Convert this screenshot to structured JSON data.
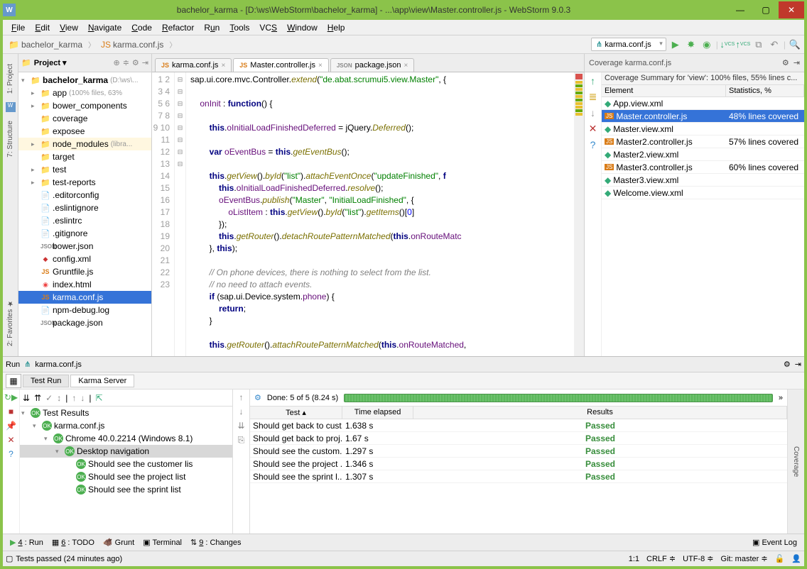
{
  "window": {
    "title": "bachelor_karma - [D:\\ws\\WebStorm\\bachelor_karma] - ...\\app\\view\\Master.controller.js - WebStorm 9.0.3"
  },
  "menu": [
    "File",
    "Edit",
    "View",
    "Navigate",
    "Code",
    "Refactor",
    "Run",
    "Tools",
    "VCS",
    "Window",
    "Help"
  ],
  "breadcrumbs": [
    "bachelor_karma",
    "karma.conf.js"
  ],
  "config_selector": "karma.conf.js",
  "project": {
    "root": "bachelor_karma",
    "root_hint": "(D:\\ws\\...",
    "items": [
      {
        "label": "app",
        "hint": "(100% files, 63%",
        "type": "folder",
        "arrow": "▸",
        "indent": 1
      },
      {
        "label": "bower_components",
        "type": "folder",
        "arrow": "▸",
        "indent": 1
      },
      {
        "label": "coverage",
        "type": "folder",
        "arrow": "",
        "indent": 1
      },
      {
        "label": "exposee",
        "type": "folder",
        "arrow": "",
        "indent": 1
      },
      {
        "label": "node_modules",
        "hint": "(libra...",
        "type": "folder",
        "arrow": "▸",
        "indent": 1,
        "lib": true
      },
      {
        "label": "target",
        "type": "folder",
        "arrow": "",
        "indent": 1
      },
      {
        "label": "test",
        "type": "folder",
        "arrow": "▸",
        "indent": 1
      },
      {
        "label": "test-reports",
        "type": "folder",
        "arrow": "▸",
        "indent": 1
      },
      {
        "label": ".editorconfig",
        "type": "file",
        "indent": 1
      },
      {
        "label": ".eslintignore",
        "type": "file",
        "indent": 1
      },
      {
        "label": ".eslintrc",
        "type": "file",
        "indent": 1
      },
      {
        "label": ".gitignore",
        "type": "file",
        "indent": 1
      },
      {
        "label": "bower.json",
        "type": "json",
        "indent": 1
      },
      {
        "label": "config.xml",
        "type": "xml",
        "indent": 1
      },
      {
        "label": "Gruntfile.js",
        "type": "js",
        "indent": 1
      },
      {
        "label": "index.html",
        "type": "html",
        "indent": 1
      },
      {
        "label": "karma.conf.js",
        "type": "js",
        "indent": 1,
        "selected": true
      },
      {
        "label": "npm-debug.log",
        "type": "file",
        "indent": 1
      },
      {
        "label": "package.json",
        "type": "json",
        "indent": 1
      }
    ]
  },
  "editor_tabs": [
    {
      "label": "karma.conf.js",
      "icon": "js",
      "active": false
    },
    {
      "label": "Master.controller.js",
      "icon": "js",
      "active": true
    },
    {
      "label": "package.json",
      "icon": "json",
      "active": false
    }
  ],
  "coverage": {
    "title": "Coverage karma.conf.js",
    "summary": "Coverage Summary for 'view': 100% files, 55% lines c...",
    "headers": [
      "Element",
      "Statistics, %"
    ],
    "rows": [
      {
        "icon": "xml",
        "name": "App.view.xml",
        "stat": ""
      },
      {
        "icon": "js",
        "name": "Master.controller.js",
        "stat": "48% lines covered",
        "selected": true
      },
      {
        "icon": "xml",
        "name": "Master.view.xml",
        "stat": ""
      },
      {
        "icon": "js",
        "name": "Master2.controller.js",
        "stat": "57% lines covered"
      },
      {
        "icon": "xml",
        "name": "Master2.view.xml",
        "stat": ""
      },
      {
        "icon": "js",
        "name": "Master3.controller.js",
        "stat": "60% lines covered"
      },
      {
        "icon": "xml",
        "name": "Master3.view.xml",
        "stat": ""
      },
      {
        "icon": "xml",
        "name": "Welcome.view.xml",
        "stat": ""
      }
    ]
  },
  "run": {
    "title": "Run",
    "config": "karma.conf.js",
    "tabs": [
      "Test Run",
      "Karma Server"
    ],
    "done_label": "Done: 5 of 5  (8.24 s)",
    "tree": [
      {
        "label": "Test Results",
        "indent": 0,
        "arrow": "▾"
      },
      {
        "label": "karma.conf.js",
        "indent": 1,
        "arrow": "▾"
      },
      {
        "label": "Chrome 40.0.2214 (Windows 8.1)",
        "indent": 2,
        "arrow": "▾"
      },
      {
        "label": "Desktop navigation",
        "indent": 3,
        "arrow": "▾",
        "selected": true
      },
      {
        "label": "Should see the customer lis",
        "indent": 4
      },
      {
        "label": "Should see the project list",
        "indent": 4
      },
      {
        "label": "Should see the sprint list",
        "indent": 4
      }
    ],
    "table_headers": [
      "Test",
      "Time elapsed",
      "Results"
    ],
    "rows": [
      {
        "test": "Should get back to cust...",
        "time": "1.638 s",
        "result": "Passed"
      },
      {
        "test": "Should get back to proj...",
        "time": "1.67 s",
        "result": "Passed"
      },
      {
        "test": "Should see the custom...",
        "time": "1.297 s",
        "result": "Passed"
      },
      {
        "test": "Should see the project ...",
        "time": "1.346 s",
        "result": "Passed"
      },
      {
        "test": "Should see the sprint l...",
        "time": "1.307 s",
        "result": "Passed"
      }
    ]
  },
  "status_buttons": [
    "4: Run",
    "6: TODO",
    "Grunt",
    "Terminal",
    "9: Changes"
  ],
  "status_right": "Event Log",
  "status2_left": "Tests passed (24 minutes ago)",
  "status2_right": {
    "pos": "1:1",
    "crlf": "CRLF",
    "enc": "UTF-8",
    "git": "Git: master"
  }
}
